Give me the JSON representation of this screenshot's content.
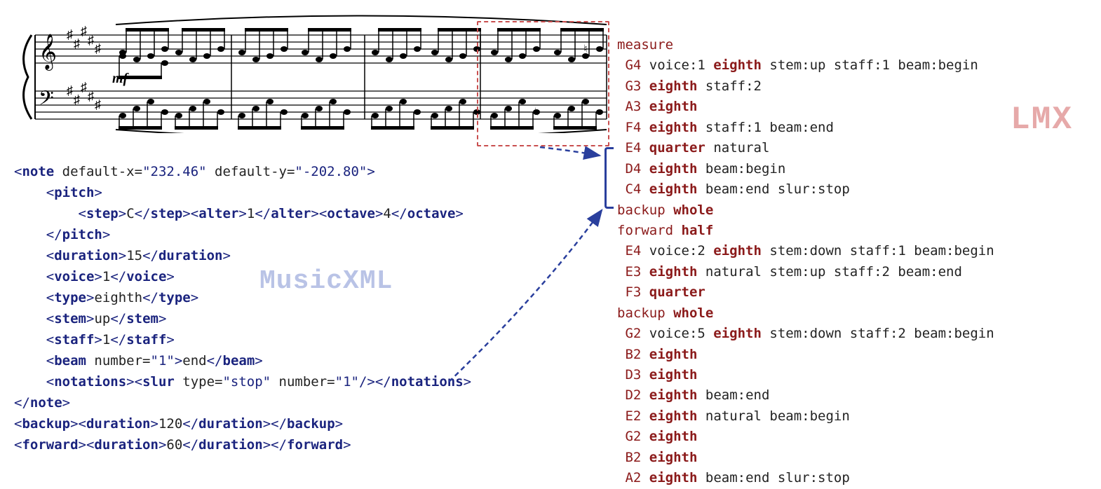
{
  "labels": {
    "musicxml": "MusicXML",
    "lmx": "LMX"
  },
  "musicxml": {
    "note_open": "<note default-x=\"232.46\" default-y=\"-202.80\">",
    "pitch_open": "<pitch>",
    "step": {
      "open": "<step>",
      "val": "C",
      "close": "</step>"
    },
    "alter": {
      "open": "<alter>",
      "val": "1",
      "close": "</alter>"
    },
    "octave": {
      "open": "<octave>",
      "val": "4",
      "close": "</octave>"
    },
    "pitch_close": "</pitch>",
    "duration": {
      "open": "<duration>",
      "val": "15",
      "close": "</duration>"
    },
    "voice": {
      "open": "<voice>",
      "val": "1",
      "close": "</voice>"
    },
    "type": {
      "open": "<type>",
      "val": "eighth",
      "close": "</type>"
    },
    "stem": {
      "open": "<stem>",
      "val": "up",
      "close": "</stem>"
    },
    "staff": {
      "open": "<staff>",
      "val": "1",
      "close": "</staff>"
    },
    "beam": {
      "open": "<beam number=\"1\">",
      "val": "end",
      "close": "</beam>"
    },
    "notations": {
      "open": "<notations>",
      "slur": "<slur type=\"stop\" number=\"1\"/>",
      "close": "</notations>"
    },
    "note_close": "</note>",
    "backup": {
      "open": "<backup>",
      "dopen": "<duration>",
      "dval": "120",
      "dclose": "</duration>",
      "close": "</backup>"
    },
    "forward": {
      "open": "<forward>",
      "dopen": "<duration>",
      "dval": "60",
      "dclose": "</duration>",
      "close": "</forward>"
    }
  },
  "lmx": [
    {
      "pitch": "measure",
      "rest": ""
    },
    {
      "indent": 1,
      "pitch": "G4",
      "rest": " voice:1 ",
      "dur": "eighth",
      "after": " stem:up staff:1 beam:begin"
    },
    {
      "indent": 1,
      "pitch": "G3",
      "rest": " ",
      "dur": "eighth",
      "after": " staff:2"
    },
    {
      "indent": 1,
      "pitch": "A3",
      "rest": " ",
      "dur": "eighth",
      "after": ""
    },
    {
      "indent": 1,
      "pitch": "F4",
      "rest": " ",
      "dur": "eighth",
      "after": " staff:1 beam:end"
    },
    {
      "indent": 1,
      "pitch": "E4",
      "rest": " ",
      "dur": "quarter",
      "after": " natural"
    },
    {
      "indent": 1,
      "pitch": "D4",
      "rest": " ",
      "dur": "eighth",
      "after": " beam:begin"
    },
    {
      "indent": 1,
      "pitch": "C4",
      "rest": " ",
      "dur": "eighth",
      "after": " beam:end slur:stop"
    },
    {
      "pitch": "backup",
      "rest": " ",
      "dur": "whole",
      "after": ""
    },
    {
      "pitch": "forward",
      "rest": " ",
      "dur": "half",
      "after": ""
    },
    {
      "indent": 1,
      "pitch": "E4",
      "rest": " voice:2 ",
      "dur": "eighth",
      "after": " stem:down staff:1 beam:begin"
    },
    {
      "indent": 1,
      "pitch": "E3",
      "rest": " ",
      "dur": "eighth",
      "after": " natural stem:up staff:2 beam:end"
    },
    {
      "indent": 1,
      "pitch": "F3",
      "rest": " ",
      "dur": "quarter",
      "after": ""
    },
    {
      "pitch": "backup",
      "rest": " ",
      "dur": "whole",
      "after": ""
    },
    {
      "indent": 1,
      "pitch": "G2",
      "rest": " voice:5 ",
      "dur": "eighth",
      "after": " stem:down staff:2 beam:begin"
    },
    {
      "indent": 1,
      "pitch": "B2",
      "rest": " ",
      "dur": "eighth",
      "after": ""
    },
    {
      "indent": 1,
      "pitch": "D3",
      "rest": " ",
      "dur": "eighth",
      "after": ""
    },
    {
      "indent": 1,
      "pitch": "D2",
      "rest": " ",
      "dur": "eighth",
      "after": " beam:end"
    },
    {
      "indent": 1,
      "pitch": "E2",
      "rest": " ",
      "dur": "eighth",
      "after": " natural beam:begin"
    },
    {
      "indent": 1,
      "pitch": "G2",
      "rest": " ",
      "dur": "eighth",
      "after": ""
    },
    {
      "indent": 1,
      "pitch": "B2",
      "rest": " ",
      "dur": "eighth",
      "after": ""
    },
    {
      "indent": 1,
      "pitch": "A2",
      "rest": " ",
      "dur": "eighth",
      "after": " beam:end slur:stop"
    }
  ]
}
